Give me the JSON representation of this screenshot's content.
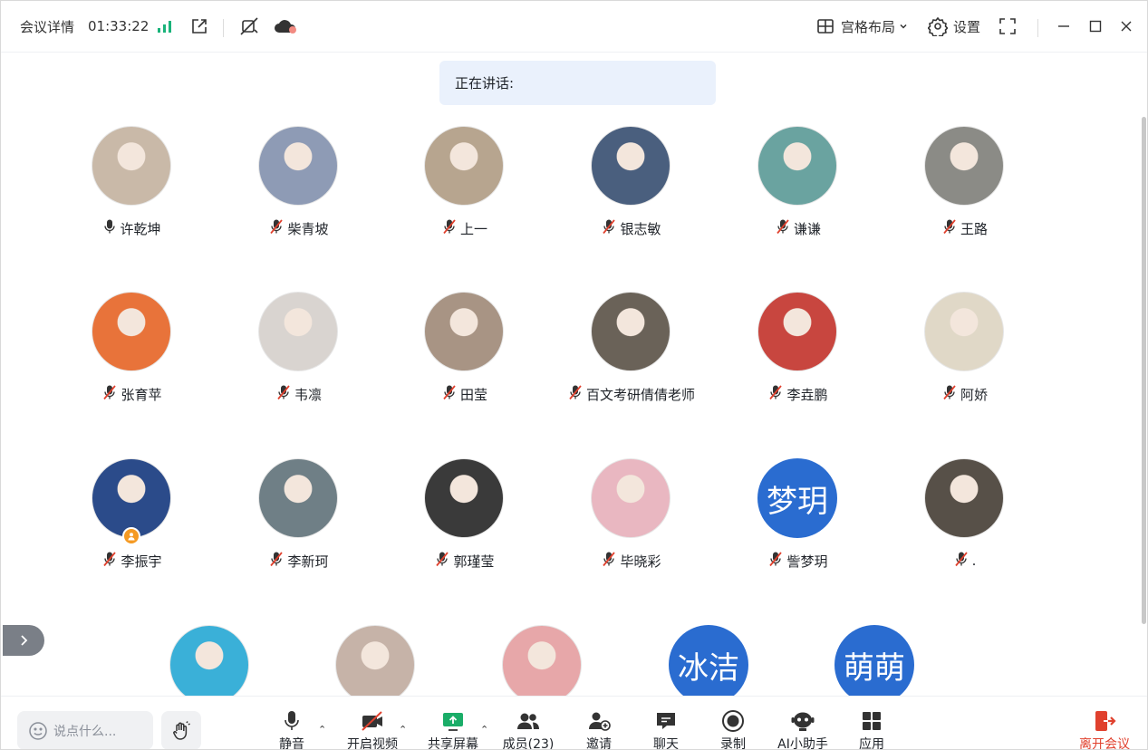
{
  "topbar": {
    "meeting_info_label": "会议详情",
    "elapsed_time": "01:33:22",
    "layout_label": "宫格布局",
    "settings_label": "设置"
  },
  "speaking": {
    "label": "正在讲话:"
  },
  "participants": [
    {
      "name": "许乾坤",
      "muted": false,
      "avatar": "photo"
    },
    {
      "name": "柴青坡",
      "muted": true,
      "avatar": "photo"
    },
    {
      "name": "上一",
      "muted": true,
      "avatar": "photo"
    },
    {
      "name": "银志敏",
      "muted": true,
      "avatar": "photo"
    },
    {
      "name": "谦谦",
      "muted": true,
      "avatar": "photo"
    },
    {
      "name": "王路",
      "muted": true,
      "avatar": "photo"
    },
    {
      "name": "张育苹",
      "muted": true,
      "avatar": "photo"
    },
    {
      "name": "韦凛",
      "muted": true,
      "avatar": "photo"
    },
    {
      "name": "田莹",
      "muted": true,
      "avatar": "photo"
    },
    {
      "name": "百文考研倩倩老师",
      "muted": true,
      "avatar": "photo"
    },
    {
      "name": "李垚鹏",
      "muted": true,
      "avatar": "photo"
    },
    {
      "name": "阿娇",
      "muted": true,
      "avatar": "photo"
    },
    {
      "name": "李振宇",
      "muted": true,
      "avatar": "photo",
      "host_badge": true
    },
    {
      "name": "李新珂",
      "muted": true,
      "avatar": "photo"
    },
    {
      "name": "郭瑾莹",
      "muted": true,
      "avatar": "photo"
    },
    {
      "name": "毕晓彩",
      "muted": true,
      "avatar": "photo"
    },
    {
      "name": "訾梦玥",
      "muted": true,
      "avatar_text": "梦玥"
    },
    {
      "name": ".",
      "muted": true,
      "avatar": "photo"
    },
    {
      "name": "",
      "avatar": "photo"
    },
    {
      "name": "",
      "avatar": "photo"
    },
    {
      "name": "",
      "avatar": "photo"
    },
    {
      "name": "",
      "avatar_text": "冰洁"
    },
    {
      "name": "",
      "avatar_text": "萌萌"
    }
  ],
  "chat": {
    "placeholder": "说点什么..."
  },
  "toolbar": {
    "mute": "静音",
    "video": "开启视频",
    "share": "共享屏幕",
    "members": "成员(23)",
    "invite": "邀请",
    "chat": "聊天",
    "record": "录制",
    "ai": "AI小助手",
    "apps": "应用",
    "leave": "离开会议"
  },
  "colors": {
    "accent": "#2a6cd0",
    "leave": "#e0412e",
    "signal": "#19b37a",
    "share": "#1aad68",
    "speaking_bg": "#eaf1fc",
    "mute_red": "#e0412e",
    "badge": "#f59a23"
  }
}
